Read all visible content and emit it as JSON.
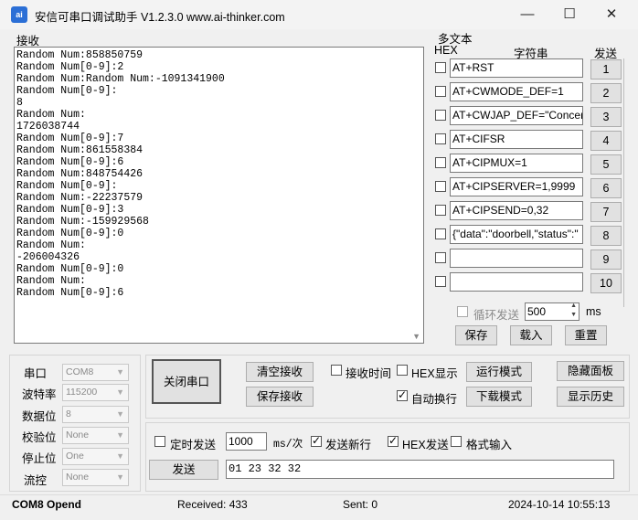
{
  "window": {
    "title": "安信可串口调试助手 V1.2.3.0    www.ai-thinker.com",
    "icon_text": "ai",
    "minimize": "—",
    "maximize": "☐",
    "close": "✕"
  },
  "receive": {
    "label": "接收",
    "lines": [
      "Random Num:858850759",
      "Random Num[0-9]:2",
      "Random Num:Random Num:-1091341900",
      "Random Num[0-9]:",
      "8",
      "Random Num:",
      "1726038744",
      "Random Num[0-9]:7",
      "Random Num:861558384",
      "Random Num[0-9]:6",
      "Random Num:848754426",
      "Random Num[0-9]:",
      "Random Num:-22237579",
      "Random Num[0-9]:3",
      "Random Num:-159929568",
      "Random Num[0-9]:0",
      "Random Num:",
      "-206004326",
      "Random Num[0-9]:0",
      "Random Num:",
      "Random Num[0-9]:6"
    ]
  },
  "multi_text": {
    "title": "多文本",
    "hex_header": "HEX",
    "string_header": "字符串",
    "send_header": "发送",
    "rows": [
      {
        "text": "AT+RST",
        "num": "1"
      },
      {
        "text": "AT+CWMODE_DEF=1",
        "num": "2"
      },
      {
        "text": "AT+CWJAP_DEF=\"Concer",
        "num": "3"
      },
      {
        "text": "AT+CIFSR",
        "num": "4"
      },
      {
        "text": "AT+CIPMUX=1",
        "num": "5"
      },
      {
        "text": "AT+CIPSERVER=1,9999",
        "num": "6"
      },
      {
        "text": "AT+CIPSEND=0,32",
        "num": "7"
      },
      {
        "text": "{\"data\":\"doorbell,\"status\":\"",
        "num": "8"
      },
      {
        "text": "",
        "num": "9"
      },
      {
        "text": "",
        "num": "10"
      }
    ],
    "loop_send_label": "循环发送",
    "loop_interval": "500",
    "loop_unit": "ms",
    "save_label": "保存",
    "load_label": "载入",
    "reset_label": "重置"
  },
  "serial": {
    "port_label": "串口",
    "port_value": "COM8",
    "baud_label": "波特率",
    "baud_value": "115200",
    "databits_label": "数据位",
    "databits_value": "8",
    "parity_label": "校验位",
    "parity_value": "None",
    "stopbits_label": "停止位",
    "stopbits_value": "One",
    "flow_label": "流控",
    "flow_value": "None"
  },
  "controls": {
    "close_port": "关闭串口",
    "clear_recv": "清空接收",
    "save_recv": "保存接收",
    "recv_time": "接收时间",
    "hex_display": "HEX显示",
    "run_mode": "运行模式",
    "hide_panel": "隐藏面板",
    "auto_wrap": "自动换行",
    "download_mode": "下载模式",
    "show_history": "显示历史",
    "timed_send": "定时发送",
    "timed_interval": "1000",
    "timed_unit": "ms/次",
    "send_newline": "发送新行",
    "hex_send": "HEX发送",
    "format_input": "格式输入",
    "send_button": "发送",
    "send_content": "01  23 32 32"
  },
  "status": {
    "port_state": "COM8 Opend",
    "received": "Received: 433",
    "sent": "Sent: 0",
    "datetime": "2024-10-14 10:55:13"
  }
}
